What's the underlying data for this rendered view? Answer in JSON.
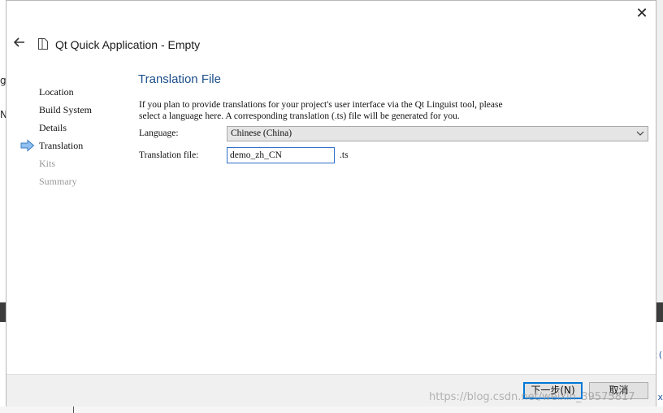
{
  "background": {
    "left_fragments": [
      "g",
      "N"
    ],
    "right_fragments": [
      "t(",
      "x"
    ]
  },
  "dialog": {
    "close_glyph": "✕",
    "title": "Qt Quick Application - Empty",
    "steps": [
      {
        "label": "Location",
        "state": "done"
      },
      {
        "label": "Build System",
        "state": "done"
      },
      {
        "label": "Details",
        "state": "done"
      },
      {
        "label": "Translation",
        "state": "current"
      },
      {
        "label": "Kits",
        "state": "pending"
      },
      {
        "label": "Summary",
        "state": "pending"
      }
    ],
    "page_title": "Translation File",
    "description_lines": [
      "If you plan to provide translations for your project's user interface via the Qt Linguist tool, please",
      "select a language here. A corresponding translation (.ts) file will be generated for you."
    ],
    "language_label": "Language:",
    "language_value": "Chinese (China)",
    "translation_file_label": "Translation file:",
    "translation_file_value": "demo_zh_CN",
    "translation_file_suffix": ".ts",
    "next_button": "下一步(N)",
    "cancel_button": "取消",
    "accent_color": "#0078d7",
    "title_color": "#1b4f8a"
  },
  "watermark": "https://blog.csdn.net/weixin_39575817"
}
